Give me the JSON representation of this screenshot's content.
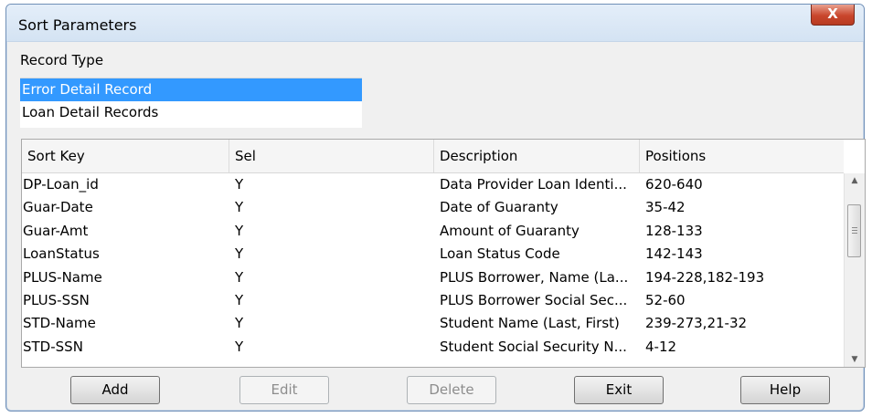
{
  "window": {
    "title": "Sort Parameters",
    "close_label": "X"
  },
  "record_type": {
    "label": "Record Type",
    "items": [
      {
        "label": "Error Detail Record",
        "selected": true
      },
      {
        "label": "Loan Detail Records",
        "selected": false
      }
    ]
  },
  "grid": {
    "headers": [
      "Sort Key",
      "Sel",
      "Description",
      "Positions"
    ],
    "rows": [
      {
        "key": "DP-Loan_id",
        "sel": "Y",
        "desc": "Data Provider Loan Identi...",
        "pos": "620-640"
      },
      {
        "key": "Guar-Date",
        "sel": "Y",
        "desc": "Date of Guaranty",
        "pos": "35-42"
      },
      {
        "key": "Guar-Amt",
        "sel": "Y",
        "desc": "Amount of Guaranty",
        "pos": "128-133"
      },
      {
        "key": "LoanStatus",
        "sel": "Y",
        "desc": "Loan Status Code",
        "pos": "142-143"
      },
      {
        "key": "PLUS-Name",
        "sel": "Y",
        "desc": "PLUS Borrower, Name (La...",
        "pos": "194-228,182-193"
      },
      {
        "key": "PLUS-SSN",
        "sel": "Y",
        "desc": "PLUS Borrower Social Sec...",
        "pos": "52-60"
      },
      {
        "key": "STD-Name",
        "sel": "Y",
        "desc": "Student Name (Last, First)",
        "pos": "239-273,21-32"
      },
      {
        "key": "STD-SSN",
        "sel": "Y",
        "desc": "Student Social Security N...",
        "pos": "4-12"
      }
    ]
  },
  "buttons": {
    "add": "Add",
    "edit": "Edit",
    "delete": "Delete",
    "exit": "Exit",
    "help": "Help"
  },
  "colors": {
    "selection": "#3399ff",
    "close_button": "#c9462c"
  }
}
